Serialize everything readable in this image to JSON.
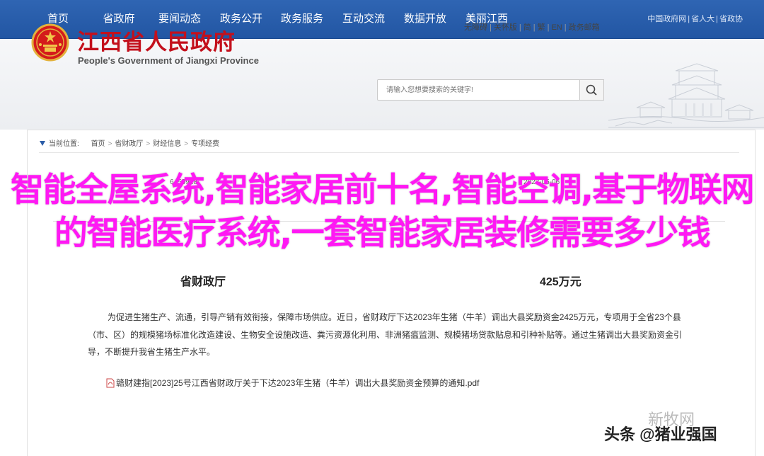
{
  "nav": {
    "items": [
      "首页",
      "省政府",
      "要闻动态",
      "政务公开",
      "政务服务",
      "互动交流",
      "数据开放",
      "美丽江西"
    ],
    "links": [
      "中国政府网",
      "省人大",
      "省政协"
    ]
  },
  "header": {
    "title": "江西省人民政府",
    "subtitle": "People's Government of Jiangxi Province",
    "tools": [
      "无障碍",
      "关怀版",
      "简",
      "繁",
      "EN",
      "政务邮箱"
    ],
    "search_placeholder": "请输入您想要搜索的关键字!"
  },
  "breadcrumb": {
    "label": "当前位置:",
    "items": [
      "首页",
      "省财政厅",
      "财经信息",
      "专项经费"
    ]
  },
  "meta": {
    "index_partial": "6450928",
    "date_partial": "2023-05-06"
  },
  "overlay": {
    "headline": "智能全屋系统,智能家居前十名,智能空调,基于物联网的智能医疗系统,一套智能家居装修需要多少钱"
  },
  "article": {
    "title_end": "425万元",
    "title_start": "省财政厅",
    "paragraph": "为促进生猪生产、流通，引导产销有效衔接，保障市场供应。近日，省财政厅下达2023年生猪（牛羊）调出大县奖励资金2425万元，专项用于全省23个县（市、区）的规模猪场标准化改造建设、生物安全设施改造、粪污资源化利用、非洲猪瘟监测、规模猪场贷款贴息和引种补贴等。通过生猪调出大县奖励资金引导，不断提升我省生猪生产水平。",
    "attachment": "赣财建指[2023]25号江西省财政厅关于下达2023年生猪（牛羊）调出大县奖励资金预算的通知.pdf"
  },
  "watermark": {
    "text": "新牧网",
    "credit": "头条 @猪业强国"
  },
  "colors": {
    "nav_bg": "#2256a3",
    "title_red": "#c3101c",
    "overlay_magenta": "#ff18f4"
  }
}
